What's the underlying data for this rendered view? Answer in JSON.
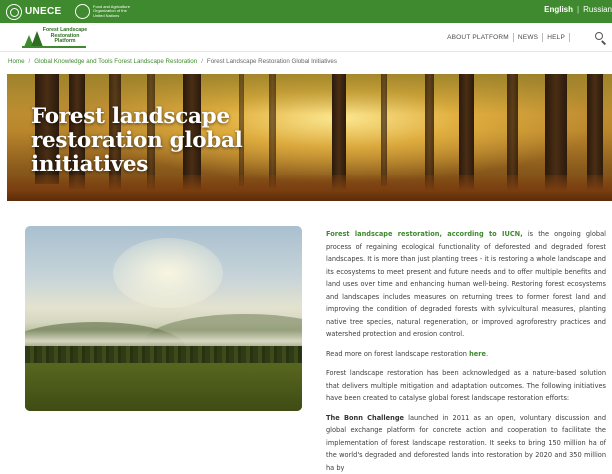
{
  "topbar": {
    "org1": "UNECE",
    "org2": "Food and Agriculture Organization of the United Nations",
    "lang_active": "English",
    "lang_separator": "|",
    "lang_other": "Russian",
    "color": "#3f8a2e"
  },
  "header": {
    "brand": "Forest Landscape Restoration Platform",
    "nav": [
      "ABOUT PLATFORM",
      "NEWS",
      "HELP"
    ],
    "search_icon": "search-icon"
  },
  "breadcrumb": {
    "items": [
      "Home",
      "Global Knowledge and Tools Forest Landscape Restoration"
    ],
    "separator": "/",
    "current": "Forest Landscape Restoration Global Initiatives"
  },
  "hero": {
    "title": "Forest landscape restoration global initiatives"
  },
  "content": {
    "p1_lead": "Forest landscape restoration, according to IUCN,",
    "p1_body": " is the ongoing global process of regaining ecological functionality of deforested and degraded forest landscapes. It is more than just planting trees - it is restoring a whole landscape and its ecosystems to meet present and future needs and to offer multiple benefits and land uses over time and enhancing human well-being. Restoring forest ecosystems and landscapes includes measures on returning trees to former forest land and improving the condition of degraded forests with sylvicultural measures, planting native tree species, natural regeneration, or improved agroforestry practices and watershed protection and erosion control.",
    "p2_text": "Read more on forest landscape restoration ",
    "p2_link": "here",
    "p2_end": ".",
    "p3": "Forest landscape restoration has been acknowledged as a nature-based solution that delivers multiple mitigation and adaptation outcomes. The following initiatives have been created to catalyse global forest landscape restoration efforts:",
    "p4_strong": "The Bonn Challenge",
    "p4_body": " launched in 2011 as an open, voluntary discussion and global exchange platform for concrete action and cooperation to facilitate the implementation of forest landscape restoration. It seeks to bring 150 million ha of the world's degraded and deforested lands into restoration by 2020 and 350 million ha by"
  }
}
